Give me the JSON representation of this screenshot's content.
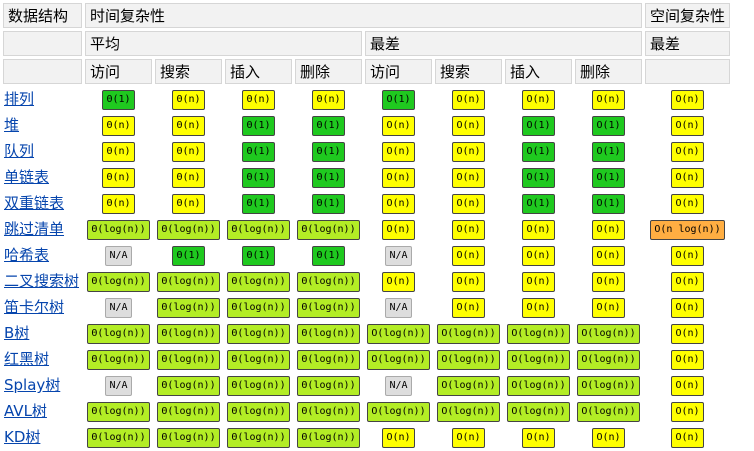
{
  "headers": {
    "row1": [
      "数据结构",
      "时间复杂性",
      "空间复杂性"
    ],
    "row2": [
      "平均",
      "最差",
      "最差"
    ],
    "ops": [
      "访问",
      "搜索",
      "插入",
      "删除",
      "访问",
      "搜索",
      "插入",
      "删除"
    ]
  },
  "rows": [
    {
      "name": "排列",
      "cells": [
        [
          "Θ(1)",
          "good"
        ],
        [
          "Θ(n)",
          "ok"
        ],
        [
          "Θ(n)",
          "ok"
        ],
        [
          "Θ(n)",
          "ok"
        ],
        [
          "O(1)",
          "good"
        ],
        [
          "O(n)",
          "ok"
        ],
        [
          "O(n)",
          "ok"
        ],
        [
          "O(n)",
          "ok"
        ],
        [
          "O(n)",
          "ok"
        ]
      ]
    },
    {
      "name": "堆",
      "cells": [
        [
          "Θ(n)",
          "ok"
        ],
        [
          "Θ(n)",
          "ok"
        ],
        [
          "Θ(1)",
          "good"
        ],
        [
          "Θ(1)",
          "good"
        ],
        [
          "O(n)",
          "ok"
        ],
        [
          "O(n)",
          "ok"
        ],
        [
          "O(1)",
          "good"
        ],
        [
          "O(1)",
          "good"
        ],
        [
          "O(n)",
          "ok"
        ]
      ]
    },
    {
      "name": "队列",
      "cells": [
        [
          "Θ(n)",
          "ok"
        ],
        [
          "Θ(n)",
          "ok"
        ],
        [
          "Θ(1)",
          "good"
        ],
        [
          "Θ(1)",
          "good"
        ],
        [
          "O(n)",
          "ok"
        ],
        [
          "O(n)",
          "ok"
        ],
        [
          "O(1)",
          "good"
        ],
        [
          "O(1)",
          "good"
        ],
        [
          "O(n)",
          "ok"
        ]
      ]
    },
    {
      "name": "单链表",
      "cells": [
        [
          "Θ(n)",
          "ok"
        ],
        [
          "Θ(n)",
          "ok"
        ],
        [
          "Θ(1)",
          "good"
        ],
        [
          "Θ(1)",
          "good"
        ],
        [
          "O(n)",
          "ok"
        ],
        [
          "O(n)",
          "ok"
        ],
        [
          "O(1)",
          "good"
        ],
        [
          "O(1)",
          "good"
        ],
        [
          "O(n)",
          "ok"
        ]
      ]
    },
    {
      "name": "双重链表",
      "cells": [
        [
          "Θ(n)",
          "ok"
        ],
        [
          "Θ(n)",
          "ok"
        ],
        [
          "Θ(1)",
          "good"
        ],
        [
          "Θ(1)",
          "good"
        ],
        [
          "O(n)",
          "ok"
        ],
        [
          "O(n)",
          "ok"
        ],
        [
          "O(1)",
          "good"
        ],
        [
          "O(1)",
          "good"
        ],
        [
          "O(n)",
          "ok"
        ]
      ]
    },
    {
      "name": "跳过清单",
      "cells": [
        [
          "Θ(log(n))",
          "fair"
        ],
        [
          "Θ(log(n))",
          "fair"
        ],
        [
          "Θ(log(n))",
          "fair"
        ],
        [
          "Θ(log(n))",
          "fair"
        ],
        [
          "O(n)",
          "ok"
        ],
        [
          "O(n)",
          "ok"
        ],
        [
          "O(n)",
          "ok"
        ],
        [
          "O(n)",
          "ok"
        ],
        [
          "O(n log(n))",
          "bad"
        ]
      ]
    },
    {
      "name": "哈希表",
      "cells": [
        [
          "N/A",
          "na"
        ],
        [
          "Θ(1)",
          "good"
        ],
        [
          "Θ(1)",
          "good"
        ],
        [
          "Θ(1)",
          "good"
        ],
        [
          "N/A",
          "na"
        ],
        [
          "O(n)",
          "ok"
        ],
        [
          "O(n)",
          "ok"
        ],
        [
          "O(n)",
          "ok"
        ],
        [
          "O(n)",
          "ok"
        ]
      ]
    },
    {
      "name": "二叉搜索树",
      "cells": [
        [
          "Θ(log(n))",
          "fair"
        ],
        [
          "Θ(log(n))",
          "fair"
        ],
        [
          "Θ(log(n))",
          "fair"
        ],
        [
          "Θ(log(n))",
          "fair"
        ],
        [
          "O(n)",
          "ok"
        ],
        [
          "O(n)",
          "ok"
        ],
        [
          "O(n)",
          "ok"
        ],
        [
          "O(n)",
          "ok"
        ],
        [
          "O(n)",
          "ok"
        ]
      ]
    },
    {
      "name": "笛卡尔树",
      "cells": [
        [
          "N/A",
          "na"
        ],
        [
          "Θ(log(n))",
          "fair"
        ],
        [
          "Θ(log(n))",
          "fair"
        ],
        [
          "Θ(log(n))",
          "fair"
        ],
        [
          "N/A",
          "na"
        ],
        [
          "O(n)",
          "ok"
        ],
        [
          "O(n)",
          "ok"
        ],
        [
          "O(n)",
          "ok"
        ],
        [
          "O(n)",
          "ok"
        ]
      ]
    },
    {
      "name": "B树",
      "cells": [
        [
          "Θ(log(n))",
          "fair"
        ],
        [
          "Θ(log(n))",
          "fair"
        ],
        [
          "Θ(log(n))",
          "fair"
        ],
        [
          "Θ(log(n))",
          "fair"
        ],
        [
          "O(log(n))",
          "fair"
        ],
        [
          "O(log(n))",
          "fair"
        ],
        [
          "O(log(n))",
          "fair"
        ],
        [
          "O(log(n))",
          "fair"
        ],
        [
          "O(n)",
          "ok"
        ]
      ]
    },
    {
      "name": "红黑树",
      "cells": [
        [
          "Θ(log(n))",
          "fair"
        ],
        [
          "Θ(log(n))",
          "fair"
        ],
        [
          "Θ(log(n))",
          "fair"
        ],
        [
          "Θ(log(n))",
          "fair"
        ],
        [
          "O(log(n))",
          "fair"
        ],
        [
          "O(log(n))",
          "fair"
        ],
        [
          "O(log(n))",
          "fair"
        ],
        [
          "O(log(n))",
          "fair"
        ],
        [
          "O(n)",
          "ok"
        ]
      ]
    },
    {
      "name": "Splay树",
      "cells": [
        [
          "N/A",
          "na"
        ],
        [
          "Θ(log(n))",
          "fair"
        ],
        [
          "Θ(log(n))",
          "fair"
        ],
        [
          "Θ(log(n))",
          "fair"
        ],
        [
          "N/A",
          "na"
        ],
        [
          "O(log(n))",
          "fair"
        ],
        [
          "O(log(n))",
          "fair"
        ],
        [
          "O(log(n))",
          "fair"
        ],
        [
          "O(n)",
          "ok"
        ]
      ]
    },
    {
      "name": "AVL树",
      "cells": [
        [
          "Θ(log(n))",
          "fair"
        ],
        [
          "Θ(log(n))",
          "fair"
        ],
        [
          "Θ(log(n))",
          "fair"
        ],
        [
          "Θ(log(n))",
          "fair"
        ],
        [
          "O(log(n))",
          "fair"
        ],
        [
          "O(log(n))",
          "fair"
        ],
        [
          "O(log(n))",
          "fair"
        ],
        [
          "O(log(n))",
          "fair"
        ],
        [
          "O(n)",
          "ok"
        ]
      ]
    },
    {
      "name": "KD树",
      "cells": [
        [
          "Θ(log(n))",
          "fair"
        ],
        [
          "Θ(log(n))",
          "fair"
        ],
        [
          "Θ(log(n))",
          "fair"
        ],
        [
          "Θ(log(n))",
          "fair"
        ],
        [
          "O(n)",
          "ok"
        ],
        [
          "O(n)",
          "ok"
        ],
        [
          "O(n)",
          "ok"
        ],
        [
          "O(n)",
          "ok"
        ],
        [
          "O(n)",
          "ok"
        ]
      ]
    }
  ],
  "colors": {
    "good": "#1fc91f",
    "fair": "#b3ed25",
    "ok": "#ffff00",
    "bad": "#ffae42",
    "na": "#dddddd"
  }
}
